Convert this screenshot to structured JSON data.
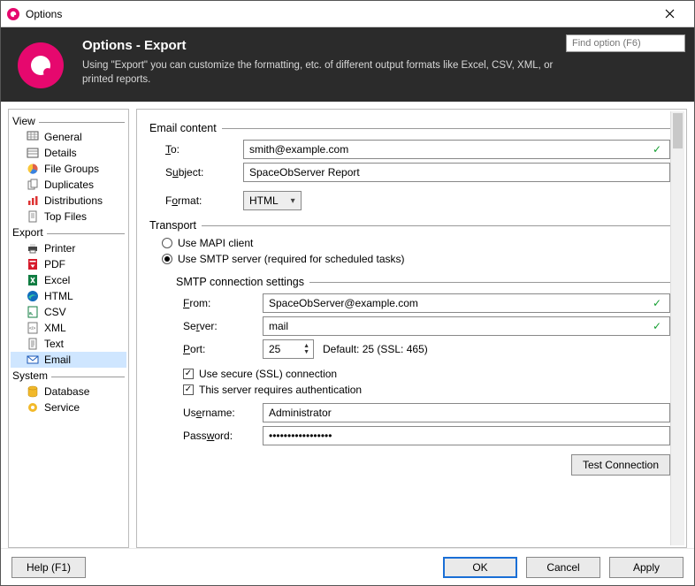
{
  "window": {
    "title": "Options"
  },
  "banner": {
    "title": "Options - Export",
    "desc": "Using \"Export\" you can customize the formatting, etc. of different output formats like Excel, CSV, XML, or printed reports.",
    "search_placeholder": "Find option (F6)"
  },
  "sidebar": {
    "groups": [
      {
        "label": "View",
        "items": [
          {
            "label": "General",
            "icon": "grid"
          },
          {
            "label": "Details",
            "icon": "table"
          },
          {
            "label": "File Groups",
            "icon": "pie"
          },
          {
            "label": "Duplicates",
            "icon": "dup"
          },
          {
            "label": "Distributions",
            "icon": "bars"
          },
          {
            "label": "Top Files",
            "icon": "doc"
          }
        ]
      },
      {
        "label": "Export",
        "items": [
          {
            "label": "Printer",
            "icon": "printer"
          },
          {
            "label": "PDF",
            "icon": "pdf"
          },
          {
            "label": "Excel",
            "icon": "excel"
          },
          {
            "label": "HTML",
            "icon": "edge"
          },
          {
            "label": "CSV",
            "icon": "csv"
          },
          {
            "label": "XML",
            "icon": "xml"
          },
          {
            "label": "Text",
            "icon": "txt"
          },
          {
            "label": "Email",
            "icon": "mail",
            "selected": true
          }
        ]
      },
      {
        "label": "System",
        "items": [
          {
            "label": "Database",
            "icon": "db"
          },
          {
            "label": "Service",
            "icon": "gear"
          }
        ]
      }
    ]
  },
  "main": {
    "email_content_label": "Email content",
    "to_label": "To:",
    "to_value": "smith@example.com",
    "subject_label": "Subject:",
    "subject_value": "SpaceObServer Report",
    "format_label": "Format:",
    "format_value": "HTML",
    "transport_label": "Transport",
    "radio_mapi": "Use MAPI client",
    "radio_smtp": "Use SMTP server (required for scheduled tasks)",
    "smtp_label": "SMTP connection settings",
    "from_label": "From:",
    "from_value": "SpaceObServer@example.com",
    "server_label": "Server:",
    "server_value": "mail",
    "port_label": "Port:",
    "port_value": "25",
    "port_hint": "Default: 25 (SSL: 465)",
    "ssl_label": "Use secure (SSL) connection",
    "auth_label": "This server requires authentication",
    "user_label": "Username:",
    "user_value": "Administrator",
    "pass_label": "Password:",
    "pass_value": "•••••••••••••••••",
    "test_btn": "Test Connection"
  },
  "footer": {
    "help": "Help (F1)",
    "ok": "OK",
    "cancel": "Cancel",
    "apply": "Apply"
  }
}
